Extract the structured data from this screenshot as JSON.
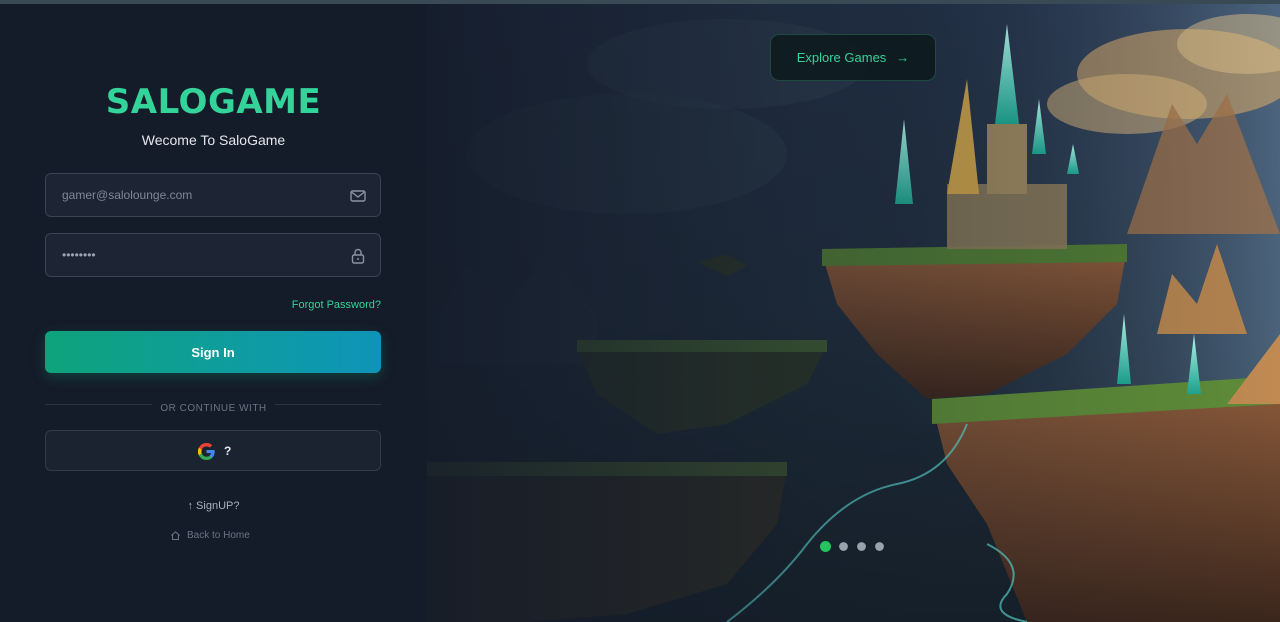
{
  "brand": {
    "name": "SALOGAME",
    "welcome": "Wecome To SaloGame"
  },
  "form": {
    "email_placeholder": "gamer@salolounge.com",
    "password_value": "••••••••",
    "email_icon": "mail-icon",
    "password_icon": "lock-icon",
    "forgot_label": "Forgot Password?",
    "signin_label": "Sign In",
    "divider_label": "OR CONTINUE WITH",
    "google_label": "?",
    "signup_label": "↑ SignUP?",
    "home_label": "Back to Home"
  },
  "hero": {
    "explore_label": "Explore Games",
    "explore_icon": "arrow-right-icon",
    "carousel": {
      "count": 4,
      "active_index": 0
    }
  },
  "colors": {
    "accent": "#34d399",
    "panel": "#141b29",
    "button_gradient_start": "#0fa37a",
    "button_gradient_end": "#0e94b8",
    "dot_active": "#22c55e"
  }
}
